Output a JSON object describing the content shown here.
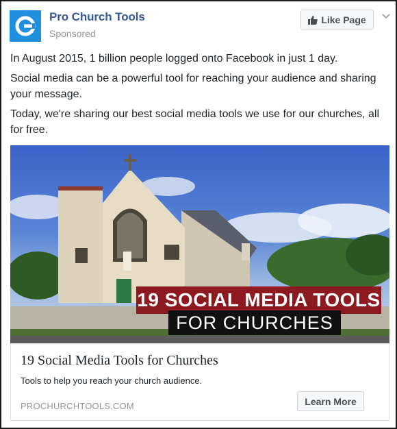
{
  "header": {
    "page_name": "Pro Church Tools",
    "sponsored_label": "Sponsored",
    "like_button_label": "Like Page",
    "brand_color": "#1f8fde"
  },
  "post": {
    "paragraphs": [
      "In August 2015, 1 billion people logged onto Facebook in just 1 day.",
      "Social media can be a powerful tool for reaching your audience and sharing your message.",
      "Today, we're sharing our best social media tools we use for our churches, all for free."
    ]
  },
  "image": {
    "banner_line1": "19 SOCIAL MEDIA TOOLS",
    "banner_line2": "FOR CHURCHES",
    "banner_line1_color": "#8c1a20"
  },
  "link": {
    "title": "19 Social Media Tools for Churches",
    "description": "Tools to help you reach your church audience.",
    "domain": "PROCHURCHTOOLS.COM",
    "cta_label": "Learn More"
  }
}
